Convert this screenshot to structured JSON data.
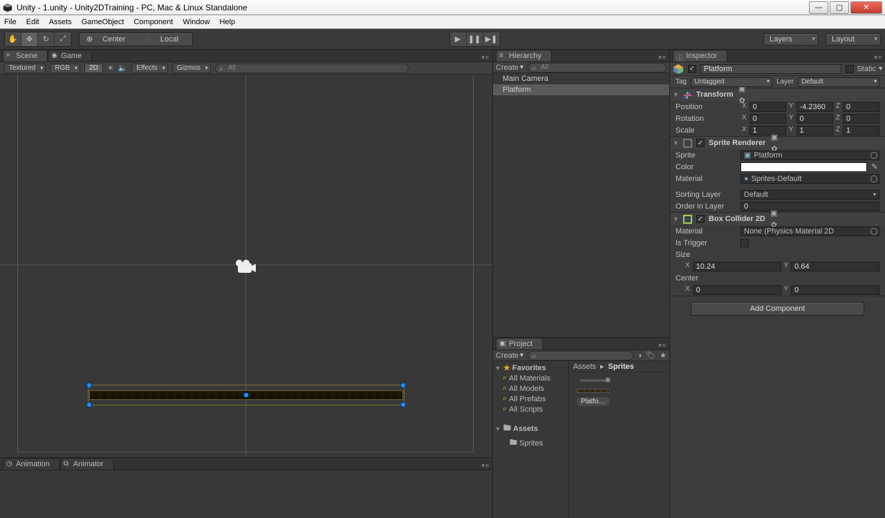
{
  "window": {
    "title": "Unity - 1.unity - Unity2DTraining - PC, Mac & Linux Standalone"
  },
  "menu": [
    "File",
    "Edit",
    "Assets",
    "GameObject",
    "Component",
    "Window",
    "Help"
  ],
  "toolbar": {
    "pivot": "Center",
    "space": "Local",
    "layers": "Layers",
    "layout": "Layout"
  },
  "scene": {
    "tab_scene": "Scene",
    "tab_game": "Game",
    "shading": "Textured",
    "rendermode": "RGB",
    "twod": "2D",
    "effects": "Effects",
    "gizmos": "Gizmos",
    "search_ph": "All"
  },
  "hierarchy": {
    "title": "Hierarchy",
    "create": "Create",
    "search_ph": "All",
    "items": [
      "Main Camera",
      "Platform"
    ],
    "selected": 1
  },
  "project": {
    "title": "Project",
    "create": "Create",
    "favorites": "Favorites",
    "fav_items": [
      "All Materials",
      "All Models",
      "All Prefabs",
      "All Scripts"
    ],
    "assets": "Assets",
    "folders": [
      "Sprites"
    ],
    "breadcrumb_root": "Assets",
    "breadcrumb_cur": "Sprites",
    "asset_item": "Platfo…"
  },
  "bottom": {
    "tab_anim": "Animation",
    "tab_animator": "Animator"
  },
  "inspector": {
    "title": "Inspector",
    "obj_name": "Platform",
    "static": "Static",
    "tag_lbl": "Tag",
    "tag_val": "Untagged",
    "layer_lbl": "Layer",
    "layer_val": "Default",
    "transform": {
      "title": "Transform",
      "position": "Position",
      "rotation": "Rotation",
      "scale": "Scale",
      "pos": {
        "x": "0",
        "y": "-4.2360",
        "z": "0"
      },
      "rot": {
        "x": "0",
        "y": "0",
        "z": "0"
      },
      "scl": {
        "x": "1",
        "y": "1",
        "z": "1"
      }
    },
    "spriterenderer": {
      "title": "Sprite Renderer",
      "sprite_lbl": "Sprite",
      "sprite_val": "Platform",
      "color_lbl": "Color",
      "material_lbl": "Material",
      "material_val": "Sprites-Default",
      "sortlayer_lbl": "Sorting Layer",
      "sortlayer_val": "Default",
      "order_lbl": "Order in Layer",
      "order_val": "0"
    },
    "boxcollider": {
      "title": "Box Collider 2D",
      "material_lbl": "Material",
      "material_val": "None (Physics Material 2D",
      "trigger_lbl": "Is Trigger",
      "size_lbl": "Size",
      "size": {
        "x": "10.24",
        "y": "0.64"
      },
      "center_lbl": "Center",
      "center": {
        "x": "0",
        "y": "0"
      }
    },
    "addcomp": "Add Component"
  }
}
